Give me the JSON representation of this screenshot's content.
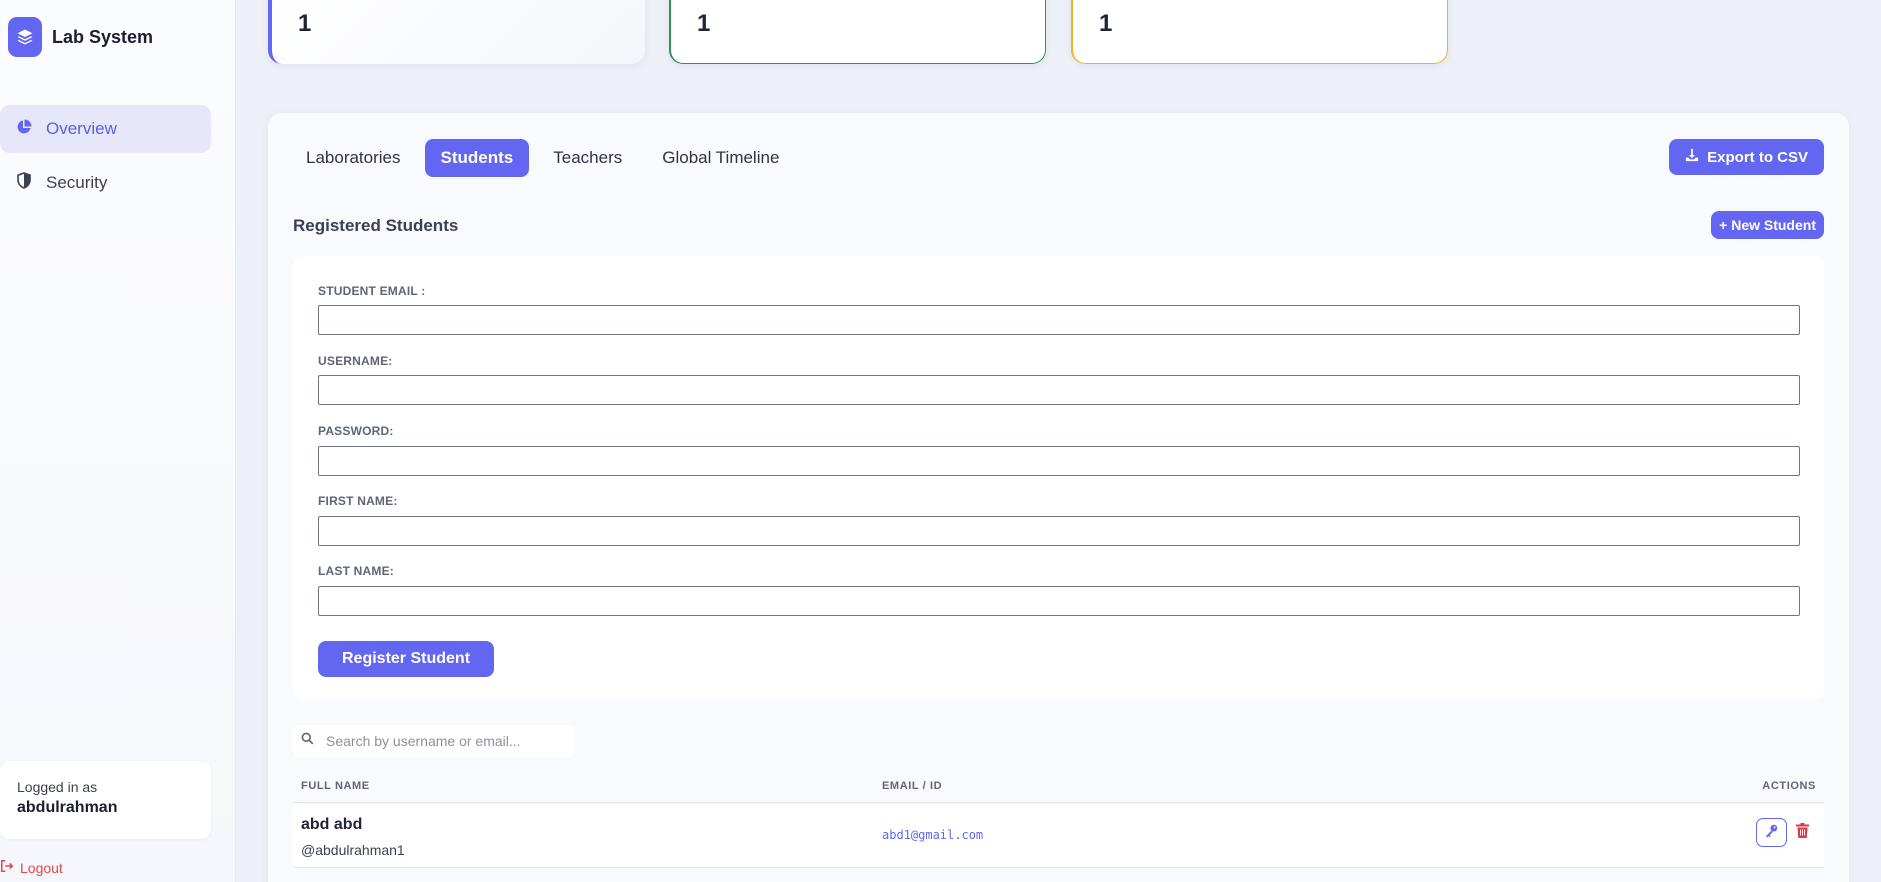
{
  "sidebar": {
    "brand_title": "Lab System",
    "items": [
      {
        "label": "Overview",
        "icon": "pie-chart-icon",
        "active": true
      },
      {
        "label": "Security",
        "icon": "shield-icon",
        "active": false
      }
    ],
    "user_label": "Logged in as",
    "username": "abdulrahman",
    "logout_label": "Logout"
  },
  "stats": [
    "1",
    "1",
    "1"
  ],
  "tabs": [
    {
      "label": "Laboratories",
      "active": false
    },
    {
      "label": "Students",
      "active": true
    },
    {
      "label": "Teachers",
      "active": false
    },
    {
      "label": "Global Timeline",
      "active": false
    }
  ],
  "toolbar": {
    "export_label": "Export to CSV"
  },
  "section": {
    "title": "Registered Students",
    "new_button": "+ New Student"
  },
  "form": {
    "fields": [
      {
        "label": "STUDENT EMAIL :",
        "value": ""
      },
      {
        "label": "USERNAME:",
        "value": ""
      },
      {
        "label": "PASSWORD:",
        "value": ""
      },
      {
        "label": "FIRST NAME:",
        "value": ""
      },
      {
        "label": "LAST NAME:",
        "value": ""
      }
    ],
    "submit_label": "Register Student"
  },
  "search": {
    "placeholder": "Search by username or email..."
  },
  "table": {
    "columns": [
      "FULL NAME",
      "EMAIL / ID",
      "ACTIONS"
    ],
    "rows": [
      {
        "full_name": "abd abd",
        "handle": "@abdulrahman1",
        "email": "abd1@gmail.com"
      }
    ]
  },
  "colors": {
    "accent": "#6366f1",
    "success": "#2f8f5b",
    "warning": "#f0b429",
    "danger": "#e04a4a"
  }
}
